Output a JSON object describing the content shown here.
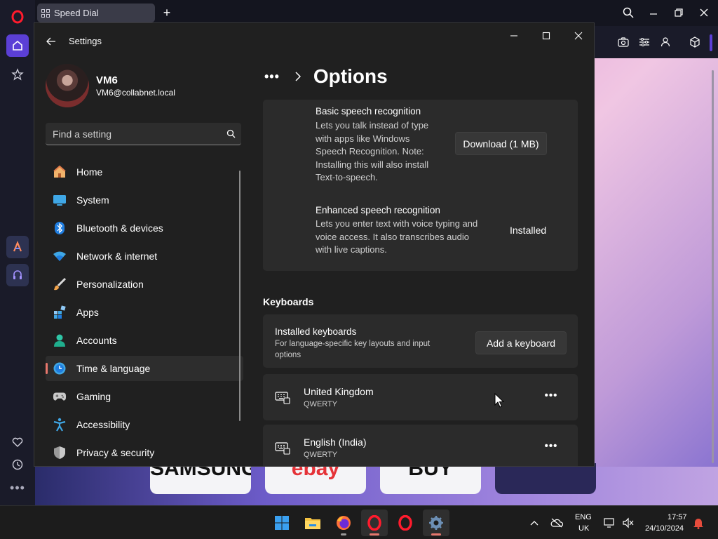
{
  "browser": {
    "tab_label": "Speed Dial",
    "new_tab_label": "+",
    "speed_dial_tiles": [
      "SAMSUNG",
      "ebay",
      "BUY",
      ""
    ]
  },
  "window": {
    "title": "Settings",
    "accent": "#e7776c"
  },
  "user": {
    "name": "VM6",
    "email": "VM6@collabnet.local"
  },
  "search": {
    "placeholder": "Find a setting"
  },
  "nav": {
    "items": [
      {
        "label": "Home",
        "icon": "home-icon"
      },
      {
        "label": "System",
        "icon": "system-icon"
      },
      {
        "label": "Bluetooth & devices",
        "icon": "bluetooth-icon"
      },
      {
        "label": "Network & internet",
        "icon": "network-icon"
      },
      {
        "label": "Personalization",
        "icon": "brush-icon"
      },
      {
        "label": "Apps",
        "icon": "apps-icon"
      },
      {
        "label": "Accounts",
        "icon": "accounts-icon"
      },
      {
        "label": "Time & language",
        "icon": "time-language-icon"
      },
      {
        "label": "Gaming",
        "icon": "gaming-icon"
      },
      {
        "label": "Accessibility",
        "icon": "accessibility-icon"
      },
      {
        "label": "Privacy & security",
        "icon": "shield-icon"
      }
    ],
    "selected": "Time & language"
  },
  "page": {
    "breadcrumb_more": "•••",
    "title": "Options"
  },
  "speech": {
    "basic_title": "Basic speech recognition",
    "basic_desc_lines": [
      "Lets you talk instead of type",
      "with apps like Windows",
      "Speech Recognition. Note:",
      "Installing this will also install",
      "Text-to-speech."
    ],
    "download_label": "Download (1 MB)",
    "enhanced_title": "Enhanced speech recognition",
    "enhanced_desc_lines": [
      "Lets you enter text with voice typing and",
      "voice access. It also transcribes audio",
      "with live captions."
    ],
    "enhanced_status": "Installed"
  },
  "keyboards": {
    "header": "Keyboards",
    "installed_title": "Installed keyboards",
    "installed_desc_lines": [
      "For language-specific key layouts and input",
      "options"
    ],
    "add_label": "Add a keyboard",
    "list": [
      {
        "name": "United Kingdom",
        "layout": "QWERTY"
      },
      {
        "name": "English (India)",
        "layout": "QWERTY"
      }
    ],
    "more_label": "•••"
  },
  "taskbar": {
    "apps": [
      "start-icon",
      "file-explorer-icon",
      "firefox-icon",
      "opera-icon",
      "opera-icon",
      "settings-icon"
    ],
    "lang_top": "ENG",
    "lang_bottom": "UK",
    "time": "17:57",
    "date": "24/10/2024"
  }
}
